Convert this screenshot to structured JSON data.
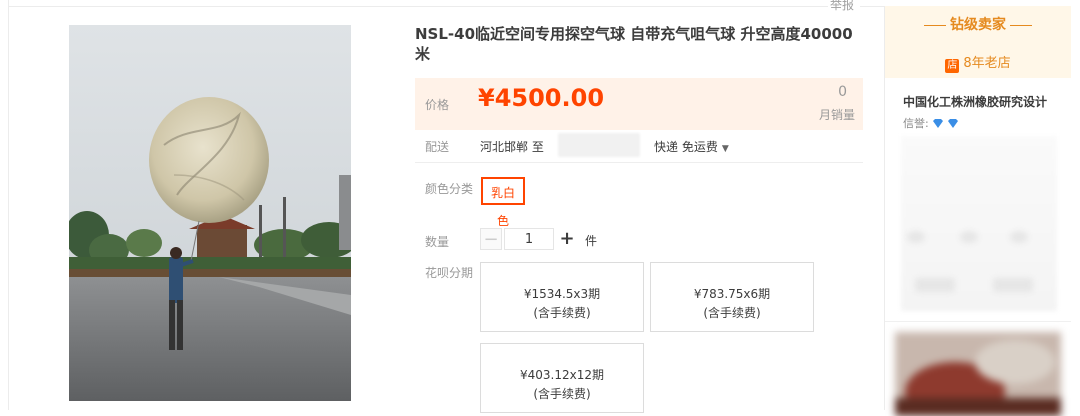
{
  "report_label": "举报",
  "product": {
    "title": "NSL-40临近空间专用探空气球 自带充气咀气球 升空高度40000米"
  },
  "price": {
    "label": "价格",
    "value": "¥4500.00",
    "sales_count": "0",
    "sales_label": "月销量"
  },
  "shipping": {
    "label": "配送",
    "from": "河北邯郸 至",
    "method": "快递 免运费"
  },
  "color": {
    "label": "颜色分类",
    "selected": "乳白色"
  },
  "quantity": {
    "label": "数量",
    "minus": "−",
    "value": "1",
    "plus": "+",
    "unit": "件"
  },
  "installments": {
    "label": "花呗分期",
    "options": [
      {
        "amount": "¥1534.5x3期",
        "fee": "(含手续费)"
      },
      {
        "amount": "¥783.75x6期",
        "fee": "(含手续费)"
      },
      {
        "amount": "¥403.12x12期",
        "fee": "(含手续费)"
      }
    ]
  },
  "seller": {
    "grade": "钻级卖家",
    "badge_char": "店",
    "age": "8年老店",
    "name": "中国化工株洲橡胶研究设计",
    "credit_label": "信誉:",
    "credit_icon": "diamond-icon",
    "credit_count": 2
  },
  "colors": {
    "accent": "#ff4400",
    "price_bg": "#fff2e8",
    "seller_orange": "#e58a1f",
    "diamond_blue": "#3a8ee6"
  }
}
